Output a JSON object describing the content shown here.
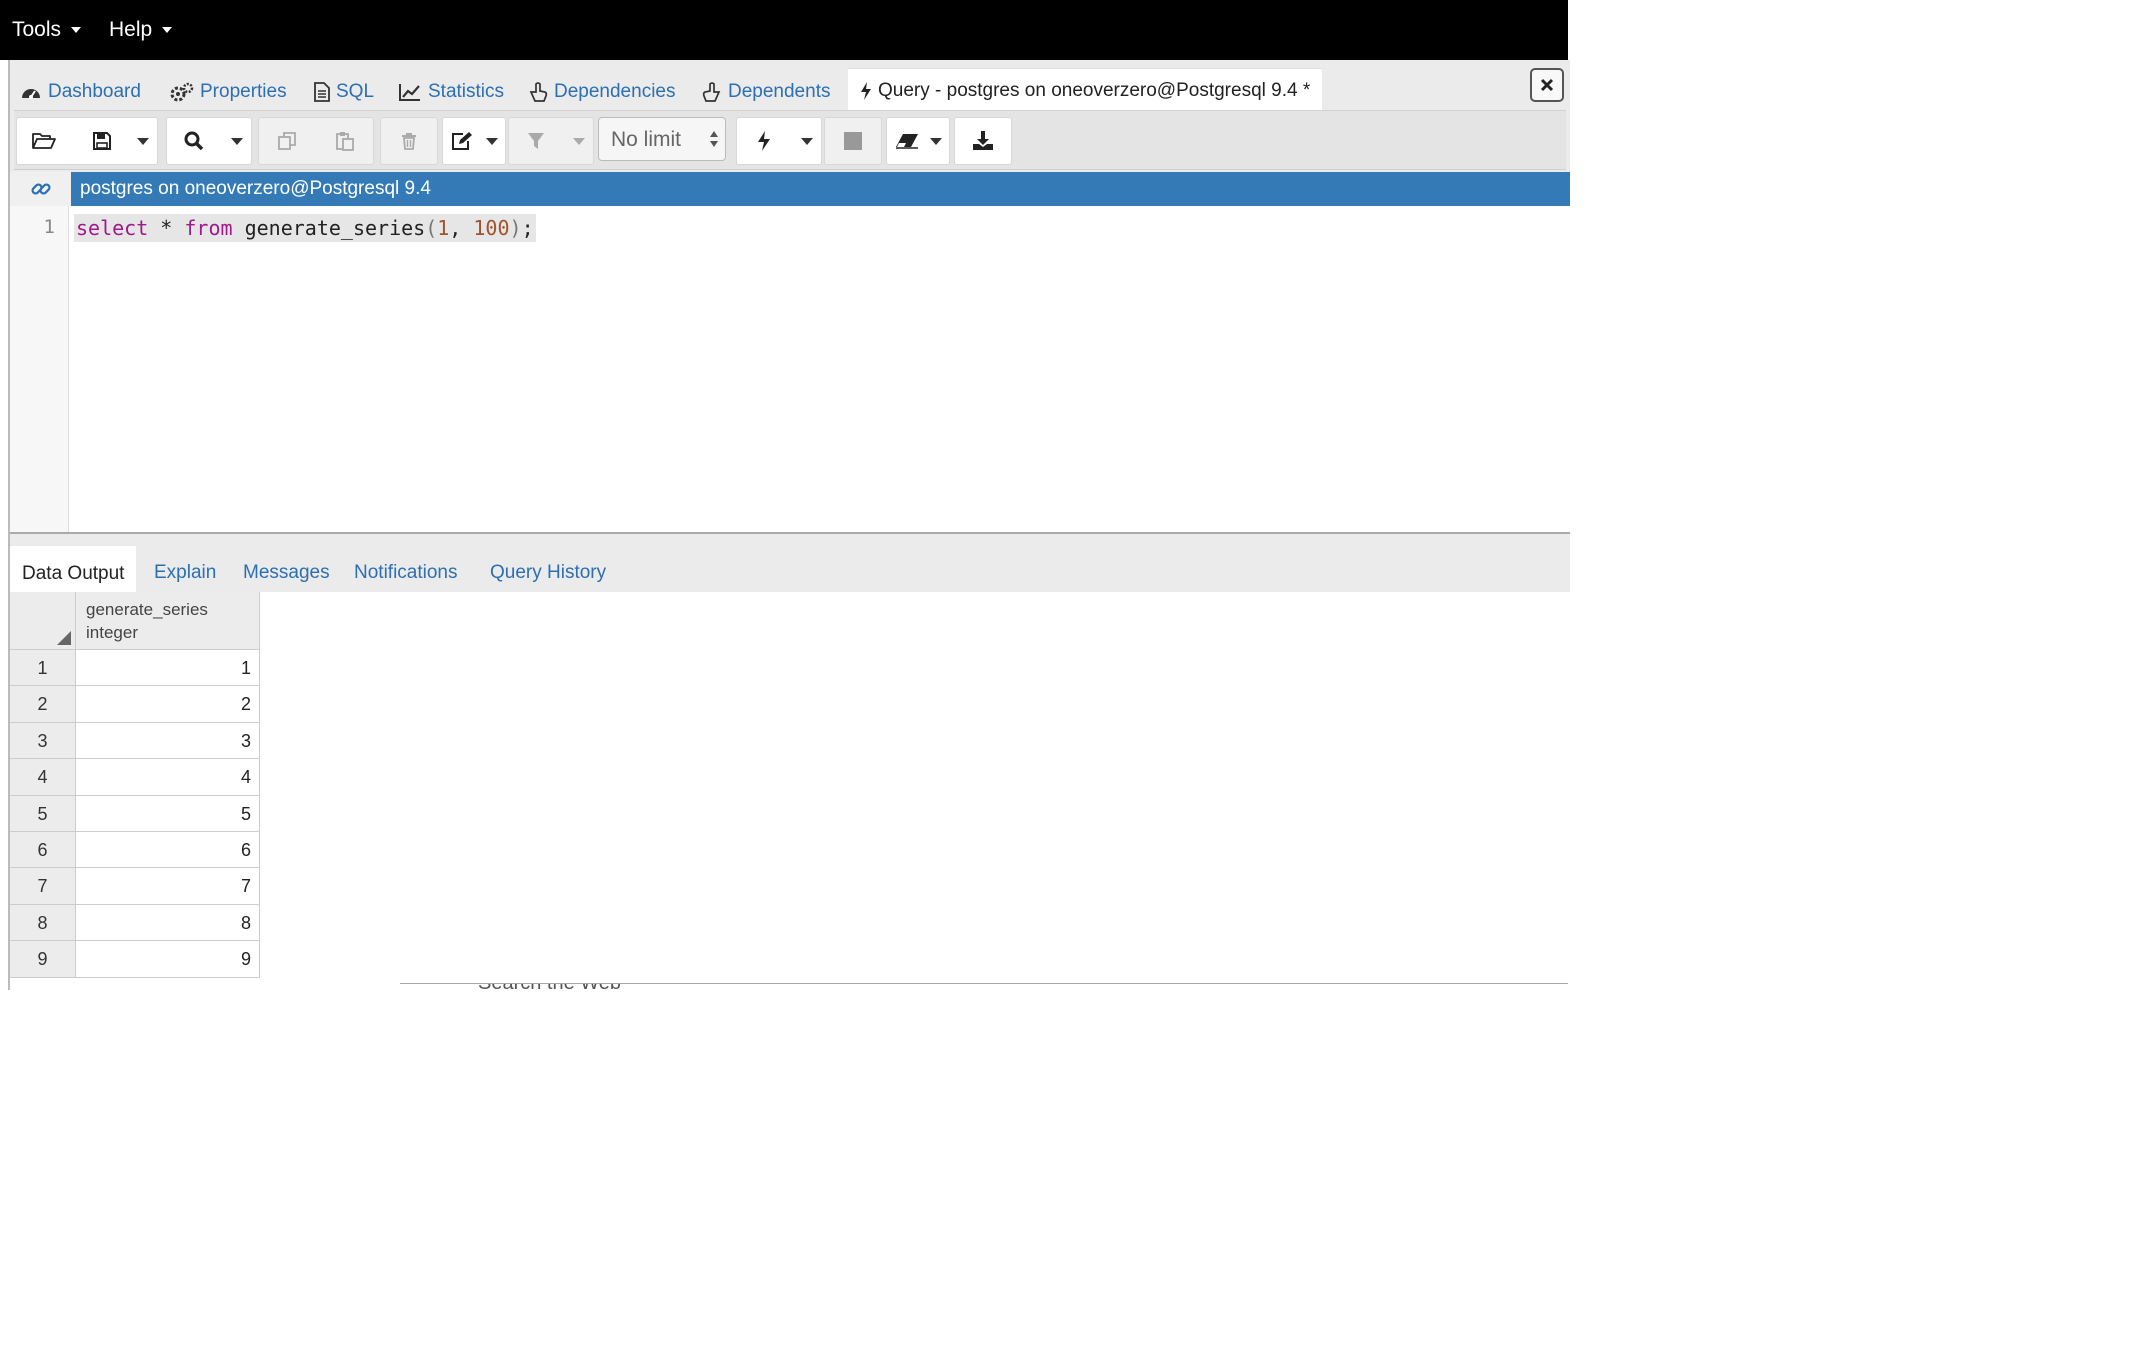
{
  "menubar": {
    "items": [
      {
        "label": "Tools"
      },
      {
        "label": "Help"
      }
    ]
  },
  "tabs": [
    {
      "label": "Dashboard",
      "icon": "dashboard-icon"
    },
    {
      "label": "Properties",
      "icon": "cogs-icon"
    },
    {
      "label": "SQL",
      "icon": "file-text-icon"
    },
    {
      "label": "Statistics",
      "icon": "line-chart-icon"
    },
    {
      "label": "Dependencies",
      "icon": "hand-pointer-icon"
    },
    {
      "label": "Dependents",
      "icon": "hand-pointer-flipped-icon"
    },
    {
      "label": "Query - postgres on oneoverzero@Postgresql 9.4 *",
      "icon": "bolt-icon"
    }
  ],
  "toolbar": {
    "limit": "No limit"
  },
  "connection": {
    "title": "postgres on oneoverzero@Postgresql 9.4"
  },
  "editor": {
    "line_number": "1",
    "tokens": {
      "select": "select",
      "star": " * ",
      "from": "from",
      "fn": " generate_series",
      "lp": "(",
      "n1": "1",
      "comma": ", ",
      "n2": "100",
      "rp": ")",
      "semi": ";"
    }
  },
  "output_tabs": [
    "Data Output",
    "Explain",
    "Messages",
    "Notifications",
    "Query History"
  ],
  "grid": {
    "column_name": "generate_series",
    "column_type": "integer",
    "rows": [
      [
        "1",
        "1"
      ],
      [
        "2",
        "2"
      ],
      [
        "3",
        "3"
      ],
      [
        "4",
        "4"
      ],
      [
        "5",
        "5"
      ],
      [
        "6",
        "6"
      ],
      [
        "7",
        "7"
      ],
      [
        "8",
        "8"
      ],
      [
        "9",
        "9"
      ]
    ]
  },
  "background_window": {
    "text": "Search the Web"
  },
  "colors": {
    "accent": "#337ab7",
    "link": "#2c6fb2",
    "keyword": "#a0188c",
    "number": "#a0532d"
  }
}
